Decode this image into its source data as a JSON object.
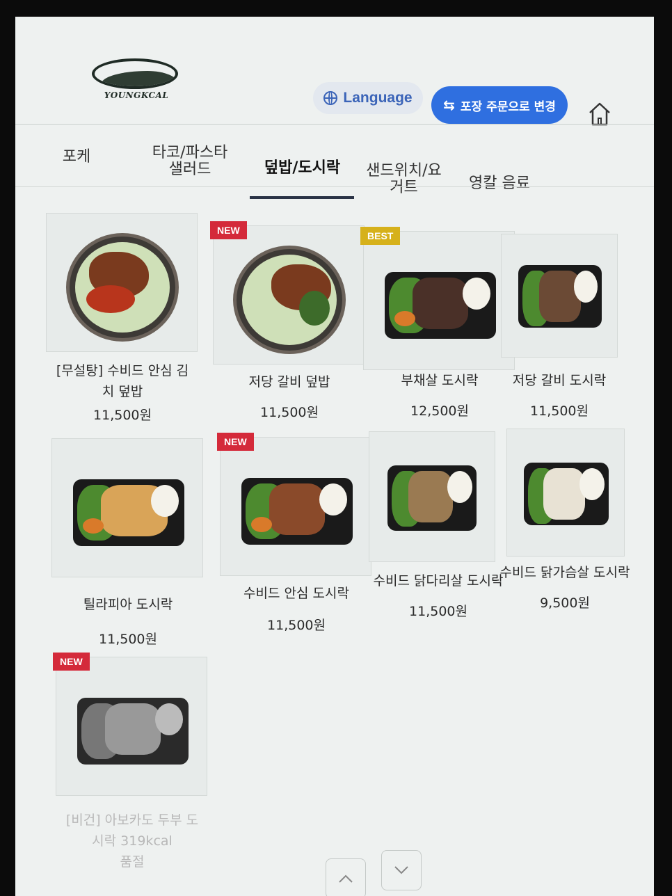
{
  "header": {
    "logo_text": "YOUNGKCAL",
    "language_label": "Language",
    "takeout_label": "포장 주문으로 변경"
  },
  "tabs": [
    {
      "label": "포케"
    },
    {
      "label": "타코/파스타\n샐러드"
    },
    {
      "label": "덮밥/도시락",
      "active": true
    },
    {
      "label": "샌드위치/요\n거트"
    },
    {
      "label": "영칼 음료"
    }
  ],
  "menu": [
    {
      "name": "[무설탕] 수비드 안심 김\n치 덮밥",
      "price": "11,500원",
      "badge": ""
    },
    {
      "name": "저당 갈비 덮밥",
      "price": "11,500원",
      "badge": "NEW"
    },
    {
      "name": "부채살 도시락",
      "price": "12,500원",
      "badge": "BEST"
    },
    {
      "name": "저당 갈비 도시락",
      "price": "11,500원",
      "badge": ""
    },
    {
      "name": "틸라피아 도시락",
      "price": "11,500원",
      "badge": ""
    },
    {
      "name": "수비드 안심 도시락",
      "price": "11,500원",
      "badge": "NEW"
    },
    {
      "name": "수비드 닭다리살 도시락",
      "price": "11,500원",
      "badge": ""
    },
    {
      "name": "수비드 닭가슴살 도시락",
      "price": "9,500원",
      "badge": ""
    },
    {
      "name": "[비건] 아보카도 두부 도\n시락 319kcal\n품절",
      "price": "",
      "badge": "NEW",
      "sold_out": true
    }
  ],
  "colors": {
    "accent_blue": "#2f6fe0",
    "new_badge": "#d42a3a",
    "best_badge": "#d6b11b"
  },
  "icons": {
    "language": "globe-icon",
    "takeout": "swap-icon",
    "home": "home-icon",
    "scroll_up": "chevron-up-icon",
    "scroll_down": "chevron-down-icon"
  }
}
